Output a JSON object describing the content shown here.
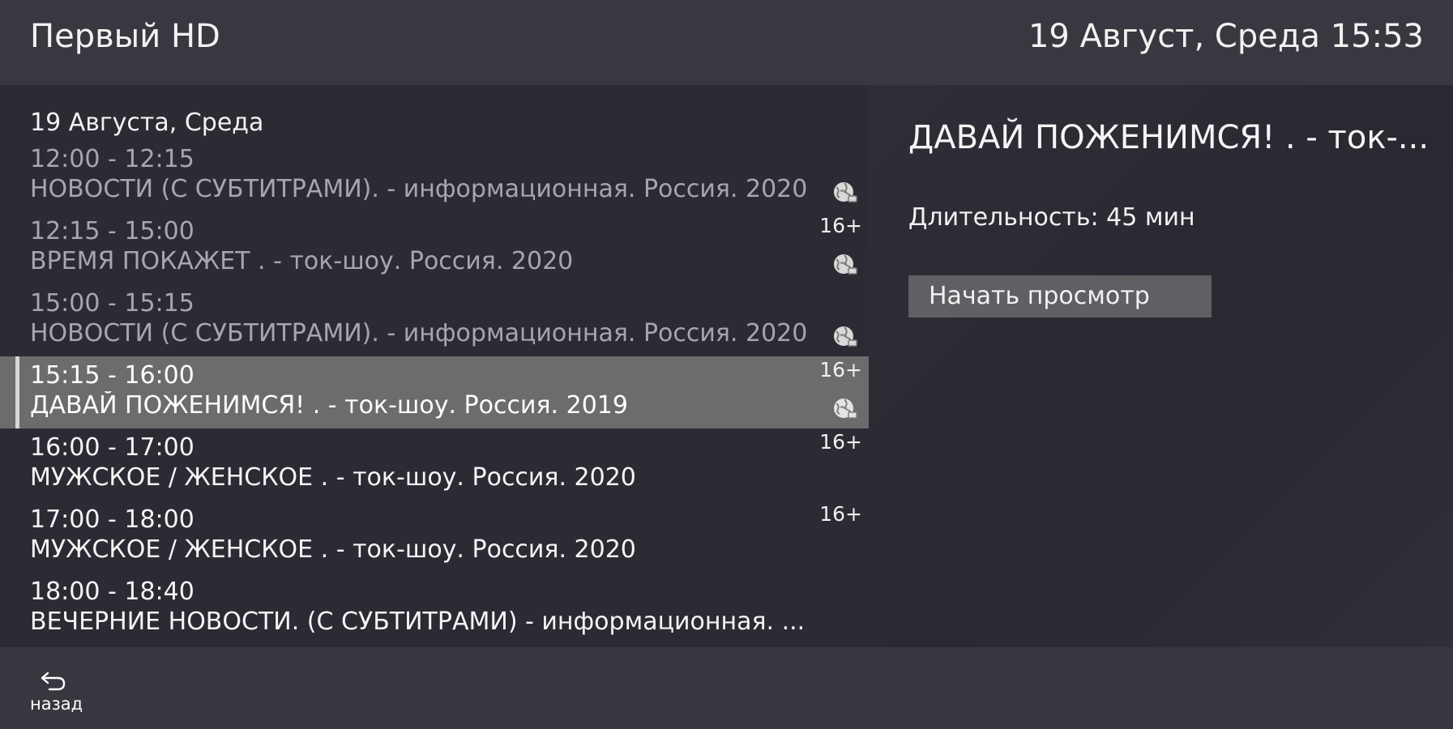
{
  "header": {
    "channel": "Первый HD",
    "datetime": "19 Август, Среда 15:53"
  },
  "epg": {
    "date_heading": "19 Августа, Среда",
    "programmes": [
      {
        "time": "12:00 - 12:15",
        "title": "НОВОСТИ (С СУБТИТРАМИ). - информационная. Россия. 2020",
        "age": "",
        "icon": "globe-icon",
        "state": "past"
      },
      {
        "time": "12:15 - 15:00",
        "title": "ВРЕМЯ ПОКАЖЕТ . - ток-шоу. Россия. 2020",
        "age": "16+",
        "icon": "globe-icon",
        "state": "past"
      },
      {
        "time": "15:00 - 15:15",
        "title": "НОВОСТИ (С СУБТИТРАМИ). - информационная. Россия. 2020",
        "age": "",
        "icon": "globe-icon",
        "state": "past"
      },
      {
        "time": "15:15 - 16:00",
        "title": "ДАВАЙ ПОЖЕНИМСЯ! . - ток-шоу. Россия. 2019",
        "age": "16+",
        "icon": "globe-icon",
        "state": "selected"
      },
      {
        "time": "16:00 - 17:00",
        "title": "МУЖСКОЕ / ЖЕНСКОЕ . - ток-шоу. Россия. 2020",
        "age": "16+",
        "icon": "",
        "state": "future"
      },
      {
        "time": "17:00 - 18:00",
        "title": "МУЖСКОЕ / ЖЕНСКОЕ . - ток-шоу. Россия. 2020",
        "age": "16+",
        "icon": "",
        "state": "future"
      },
      {
        "time": "18:00 - 18:40",
        "title": "ВЕЧЕРНИЕ НОВОСТИ. (С СУБТИТРАМИ) - информационная. ...",
        "age": "",
        "icon": "",
        "state": "future"
      }
    ]
  },
  "details": {
    "title": "ДАВАЙ ПОЖЕНИМСЯ! . - ток-...",
    "duration": "Длительность: 45 мин",
    "watch_label": "Начать просмотр"
  },
  "footer": {
    "back_icon": "back-arrow-icon",
    "back_label": "назад"
  },
  "colors": {
    "background": "#26262f",
    "header": "#383840",
    "list": "#2b2b34",
    "selected_row": "#6c6c6e",
    "past_text": "#a6a6ad",
    "button": "#5f5f64"
  }
}
